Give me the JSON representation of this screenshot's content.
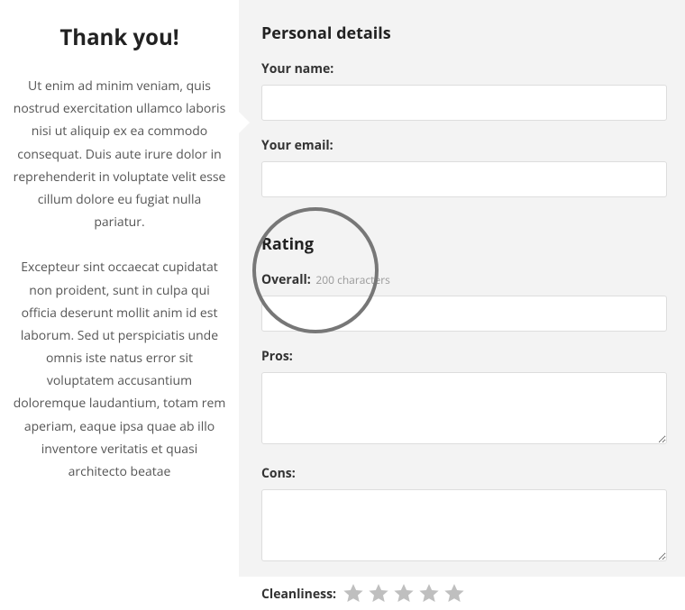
{
  "left": {
    "title": "Thank you!",
    "para1": "Ut enim ad minim veniam, quis nostrud exercitation ullamco laboris nisi ut aliquip ex ea commodo consequat. Duis aute irure dolor in reprehenderit in voluptate velit esse cillum dolore eu fugiat nulla pariatur.",
    "para2": "Excepteur sint occaecat cupidatat non proident, sunt in culpa qui officia deserunt mollit anim id est laborum. Sed ut perspiciatis unde omnis iste natus error sit voluptatem accusantium doloremque laudantium, totam rem aperiam, eaque ipsa quae ab illo inventore veritatis et quasi architecto beatae"
  },
  "form": {
    "personal_heading": "Personal details",
    "name_label": "Your name:",
    "name_value": "",
    "email_label": "Your email:",
    "email_value": "",
    "rating_heading": "Rating",
    "overall_label": "Overall:",
    "overall_hint": "200 characters",
    "overall_value": "",
    "pros_label": "Pros:",
    "pros_value": "",
    "cons_label": "Cons:",
    "cons_value": "",
    "cleanliness_label": "Cleanliness:",
    "star_count": 5
  }
}
